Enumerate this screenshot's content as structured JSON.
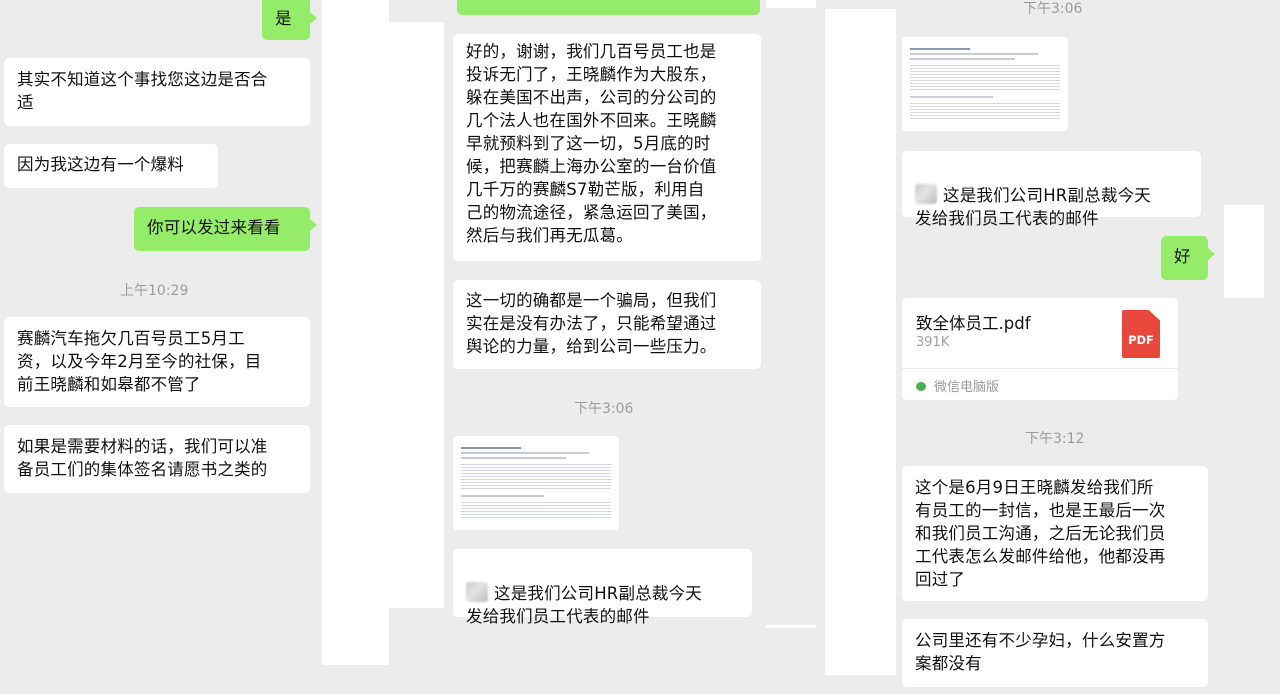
{
  "col1": {
    "msg_yes": "是",
    "msg_q1": "其实不知道这个事找您这边是否合\n适",
    "msg_q2": "因为我这边有一个爆料",
    "msg_send": "你可以发过来看看",
    "time1": "上午10:29",
    "msg_arrears": "赛麟汽车拖欠几百号员工5月工\n资，以及今年2月至今的社保，目\n前王晓麟和如皋都不管了",
    "msg_materials": "如果是需要材料的话，我们可以准\n备员工们的集体签名请愿书之类的"
  },
  "col2": {
    "msg_long": "好的，谢谢，我们几百号员工也是\n投诉无门了，王晓麟作为大股东，\n躲在美国不出声，公司的分公司的\n几个法人也在国外不回来。王晓麟\n早就预料到了这一切，5月底的时\n候，把赛麟上海办公室的一台价值\n几千万的赛麟S7勒芒版，利用自\n己的物流途径，紧急运回了美国，\n然后与我们再无瓜葛。",
    "msg_scam": "这一切的确都是一个骗局，但我们\n实在是没有办法了，只能希望通过\n舆论的力量，给到公司一些压力。",
    "time2": "下午3:06",
    "msg_email_l1": "这是我们公司HR副总裁今天",
    "msg_email_l2": "发给我们员工代表的邮件"
  },
  "col3": {
    "time_top": "下午3:06",
    "msg_email_l1": "这是我们公司HR副总裁今天",
    "msg_email_l2": "发给我们员工代表的邮件",
    "msg_ok": "好",
    "file": {
      "name": "致全体员工.pdf",
      "size": "391K",
      "icon_label": "PDF",
      "source": "微信电脑版"
    },
    "time3": "下午3:12",
    "msg_letter": "这个是6月9日王晓麟发给我们所\n有员工的一封信，也是王最后一次\n和我们员工沟通，之后无论我们员\n工代表怎么发邮件给他，他都没再\n回过了",
    "msg_pregnant": "公司里还有不少孕妇，什么安置方\n案都没有"
  },
  "colors": {
    "background": "#ececec",
    "sent_bubble": "#95ec69",
    "received_bubble": "#ffffff",
    "timestamp": "#9b9b9b",
    "pdf_red": "#e8473b"
  }
}
